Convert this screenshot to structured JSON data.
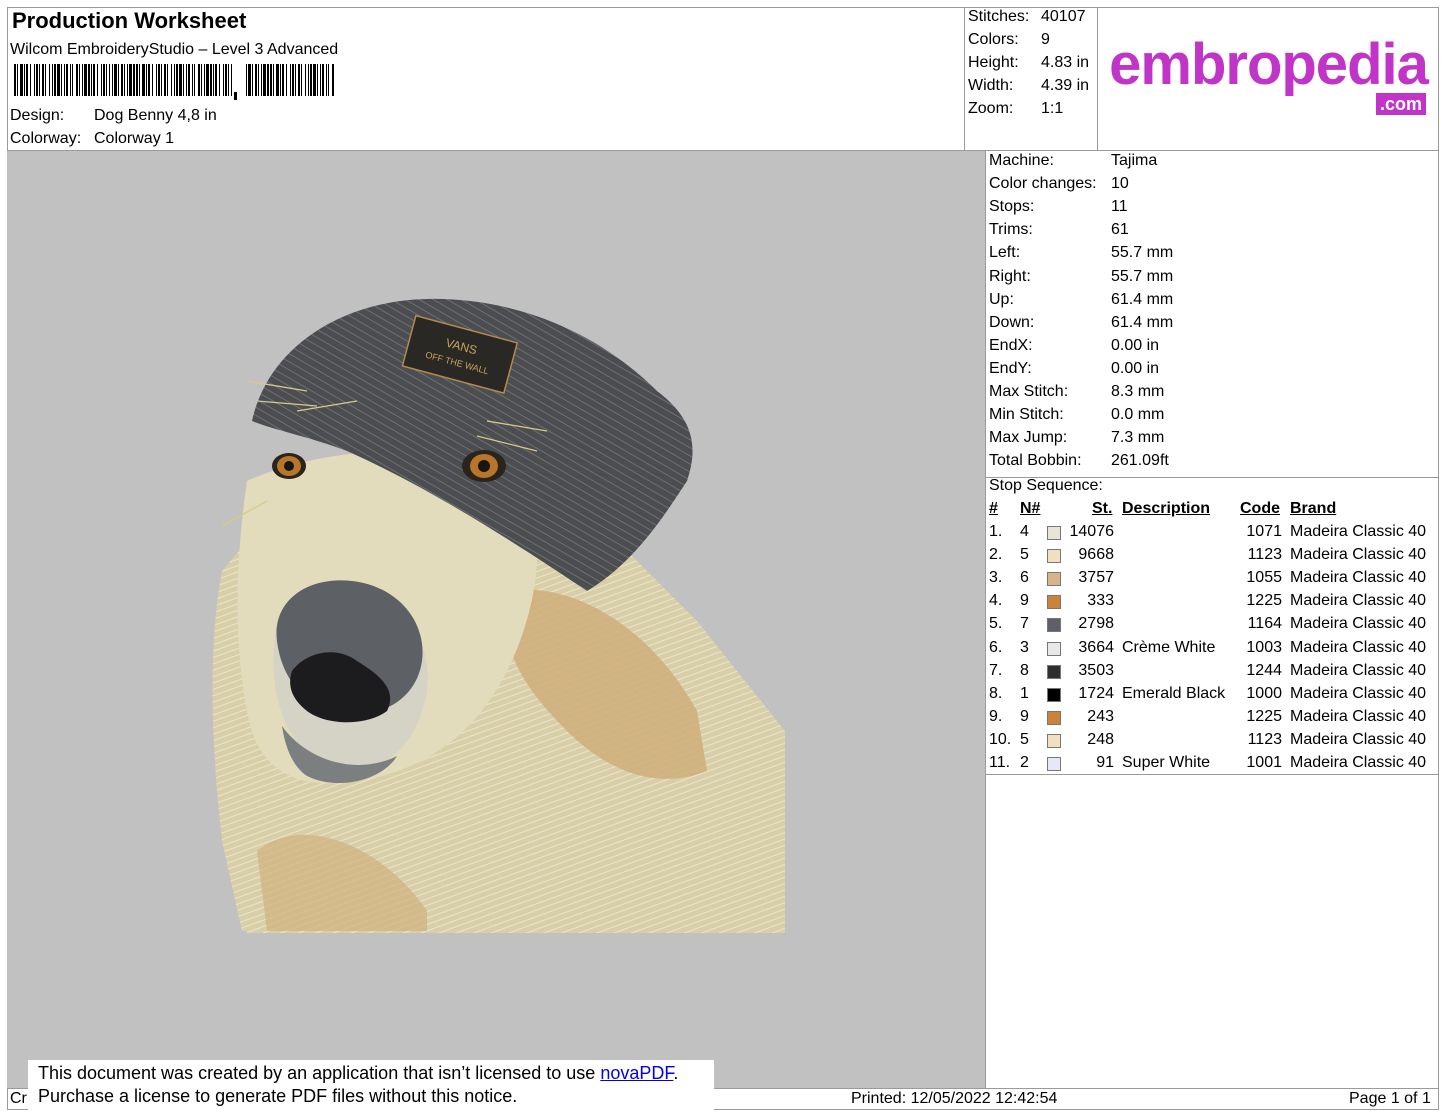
{
  "header": {
    "title": "Production Worksheet",
    "subtitle": "Wilcom EmbroideryStudio – Level 3 Advanced",
    "design_label": "Design:",
    "design_value": "Dog Benny 4,8 in",
    "colorway_label": "Colorway:",
    "colorway_value": "Colorway 1"
  },
  "stats": [
    {
      "label": "Stitches:",
      "value": "40107"
    },
    {
      "label": "Colors:",
      "value": "9"
    },
    {
      "label": "Height:",
      "value": "4.83 in"
    },
    {
      "label": "Width:",
      "value": "4.39 in"
    },
    {
      "label": "Zoom:",
      "value": "1:1"
    }
  ],
  "logo": {
    "text": "embropedia",
    "suffix": ".com",
    "color": "#c034c8"
  },
  "machine_info": [
    {
      "label": "Machine:",
      "value": "Tajima"
    },
    {
      "label": "Color changes:",
      "value": "10"
    },
    {
      "label": "Stops:",
      "value": "11"
    },
    {
      "label": "Trims:",
      "value": "61"
    },
    {
      "label": "Left:",
      "value": "55.7 mm"
    },
    {
      "label": "Right:",
      "value": "55.7 mm"
    },
    {
      "label": "Up:",
      "value": "61.4 mm"
    },
    {
      "label": "Down:",
      "value": "61.4 mm"
    },
    {
      "label": "EndX:",
      "value": "0.00 in"
    },
    {
      "label": "EndY:",
      "value": "0.00 in"
    },
    {
      "label": "Max Stitch:",
      "value": "8.3 mm"
    },
    {
      "label": "Min Stitch:",
      "value": "0.0 mm"
    },
    {
      "label": "Max Jump:",
      "value": "7.3 mm"
    },
    {
      "label": "Total Bobbin:",
      "value": "261.09ft"
    }
  ],
  "stop_sequence": {
    "title": "Stop Sequence:",
    "headers": {
      "num": "#",
      "n": "N#",
      "st": "St.",
      "desc": "Description",
      "code": "Code",
      "brand": "Brand"
    },
    "rows": [
      {
        "num": "1.",
        "n": "4",
        "color": "#e9e5d6",
        "st": "14076",
        "desc": "",
        "code": "1071",
        "brand": "Madeira Classic 40"
      },
      {
        "num": "2.",
        "n": "5",
        "color": "#f2dfc0",
        "st": "9668",
        "desc": "",
        "code": "1123",
        "brand": "Madeira Classic 40"
      },
      {
        "num": "3.",
        "n": "6",
        "color": "#d8b48a",
        "st": "3757",
        "desc": "",
        "code": "1055",
        "brand": "Madeira Classic 40"
      },
      {
        "num": "4.",
        "n": "9",
        "color": "#c9843a",
        "st": "333",
        "desc": "",
        "code": "1225",
        "brand": "Madeira Classic 40"
      },
      {
        "num": "5.",
        "n": "7",
        "color": "#5d6066",
        "st": "2798",
        "desc": "",
        "code": "1164",
        "brand": "Madeira Classic 40"
      },
      {
        "num": "6.",
        "n": "3",
        "color": "#e8e8e6",
        "st": "3664",
        "desc": "Crème White",
        "code": "1003",
        "brand": "Madeira Classic 40"
      },
      {
        "num": "7.",
        "n": "8",
        "color": "#2e2f33",
        "st": "3503",
        "desc": "",
        "code": "1244",
        "brand": "Madeira Classic 40"
      },
      {
        "num": "8.",
        "n": "1",
        "color": "#000000",
        "st": "1724",
        "desc": "Emerald Black",
        "code": "1000",
        "brand": "Madeira Classic 40"
      },
      {
        "num": "9.",
        "n": "9",
        "color": "#c9843a",
        "st": "243",
        "desc": "",
        "code": "1225",
        "brand": "Madeira Classic 40"
      },
      {
        "num": "10.",
        "n": "5",
        "color": "#f2dfc0",
        "st": "248",
        "desc": "",
        "code": "1123",
        "brand": "Madeira Classic 40"
      },
      {
        "num": "11.",
        "n": "2",
        "color": "#e6e8f8",
        "st": "91",
        "desc": "Super White",
        "code": "1001",
        "brand": "Madeira Classic 40"
      }
    ]
  },
  "footer": {
    "left_fragment": "Cr",
    "printed": "Printed: 12/05/2022 12:42:54",
    "page": "Page 1 of 1"
  },
  "notice": {
    "line1_prefix": "This document was created by an application that isn’t licensed to use ",
    "link": "novaPDF",
    "line1_suffix": ".",
    "line2": "Purchase a license to generate PDF files without this notice."
  },
  "hat_patch": {
    "line1": "VANS",
    "line2": "OFF THE WALL"
  }
}
